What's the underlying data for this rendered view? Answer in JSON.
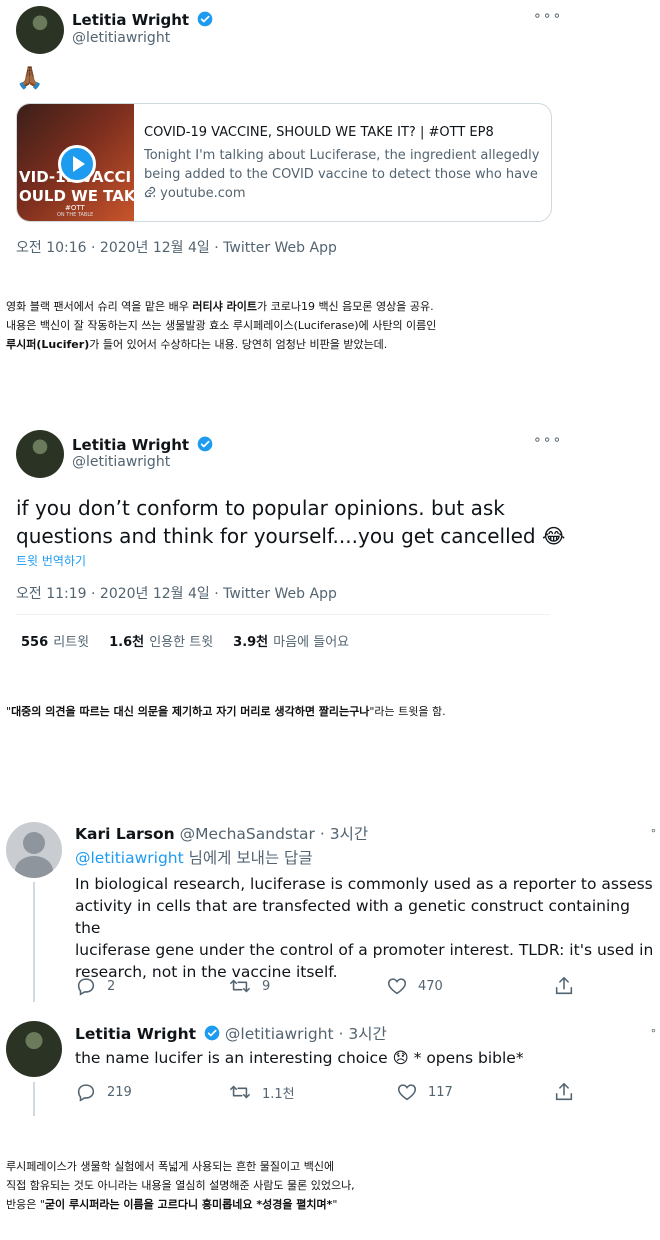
{
  "tweet1": {
    "name": "Letitia Wright",
    "handle": "@letitiawright",
    "emoji": "🙏🏾",
    "card": {
      "thumb_text": "VID-19 VACCI\nOULD WE TAKE",
      "thumb_tag": "#OTT",
      "thumb_sub": "ON THE TABLE",
      "title": "COVID-19 VACCINE, SHOULD WE TAKE IT? | #OTT EP8",
      "desc_line1": "Tonight I'm talking about Luciferase, the ingredient allegedly",
      "desc_line2": "being added to the COVID vaccine to detect those who have ...",
      "domain": "youtube.com"
    },
    "meta": "오전 10:16 · 2020년 12월 4일 · Twitter Web App"
  },
  "caption1": {
    "line1_pre": "영화 블랙 팬서에서 슈리 역을 맡은 배우 ",
    "line1_bold": "러티샤 라이트",
    "line1_post": "가 코로나19 백신 음모론 영상을 공유.",
    "line2": "내용은 백신이 잘 작동하는지 쓰는 생물발광 효소 루시페레이스(Luciferase)에 사탄의 이름인",
    "line3_bold": "루시퍼(Lucifer)",
    "line3_post": "가 들어 있어서 수상하다는 내용. 당연히 엄청난 비판을 받았는데."
  },
  "tweet2": {
    "name": "Letitia Wright",
    "handle": "@letitiawright",
    "text_line1": "if you don’t conform to popular opinions. but ask",
    "text_line2": "questions and think for yourself....you get cancelled",
    "emoji": "😂",
    "translate": "트윗 번역하기",
    "meta": "오전 11:19 · 2020년 12월 4일 · Twitter Web App",
    "stats": [
      {
        "num": "556",
        "label": "리트윗"
      },
      {
        "num": "1.6천",
        "label": "인용한 트윗"
      },
      {
        "num": "3.9천",
        "label": "마음에 들어요"
      }
    ]
  },
  "caption2": {
    "open_quote": "\"",
    "bold": "대중의 의견을 따르는 대신 의문을 제기하고 자기 머리로 생각하면 짤리는구나",
    "close": "\"라는 트윗을 함."
  },
  "reply1": {
    "name": "Kari Larson",
    "handle": "@MechaSandstar",
    "time": "· 3시간",
    "reply_to_handle": "@letitiawright",
    "reply_to_suffix": " 님에게 보내는 답글",
    "text_line1": "In biological research, luciferase is commonly used as a reporter to assess",
    "text_line2": "activity in cells that are transfected with a genetic construct containing the",
    "text_line3": "luciferase gene under the control of a promoter interest.  TLDR: it's used in",
    "text_line4": "research, not in the vaccine itself.",
    "actions": {
      "reply": "2",
      "retweet": "9",
      "like": "470"
    }
  },
  "reply2": {
    "name": "Letitia Wright",
    "handle": "@letitiawright",
    "time": "· 3시간",
    "text_pre": "the name lucifer is an interesting choice ",
    "emoji": "😞",
    "text_post": " * opens bible*",
    "actions": {
      "reply": "219",
      "retweet": "1.1천",
      "like": "117"
    }
  },
  "caption3": {
    "line1": "루시페레이스가 생물학 실험에서 폭넓게 사용되는 흔한 물질이고 백신에",
    "line2": "직접 함유되는 것도 아니라는 내용을 열심히 설명해준 사람도 물론 있었으나,",
    "line3_pre": "반응은 \"",
    "line3_bold": "굳이 루시퍼라는 이름을 고르다니 흥미롭네요 *성경을 펼치며*",
    "line3_post": "\""
  },
  "colors": {
    "accent": "#1d9bf0",
    "secondary_text": "#536471",
    "border": "#cfd9de"
  }
}
